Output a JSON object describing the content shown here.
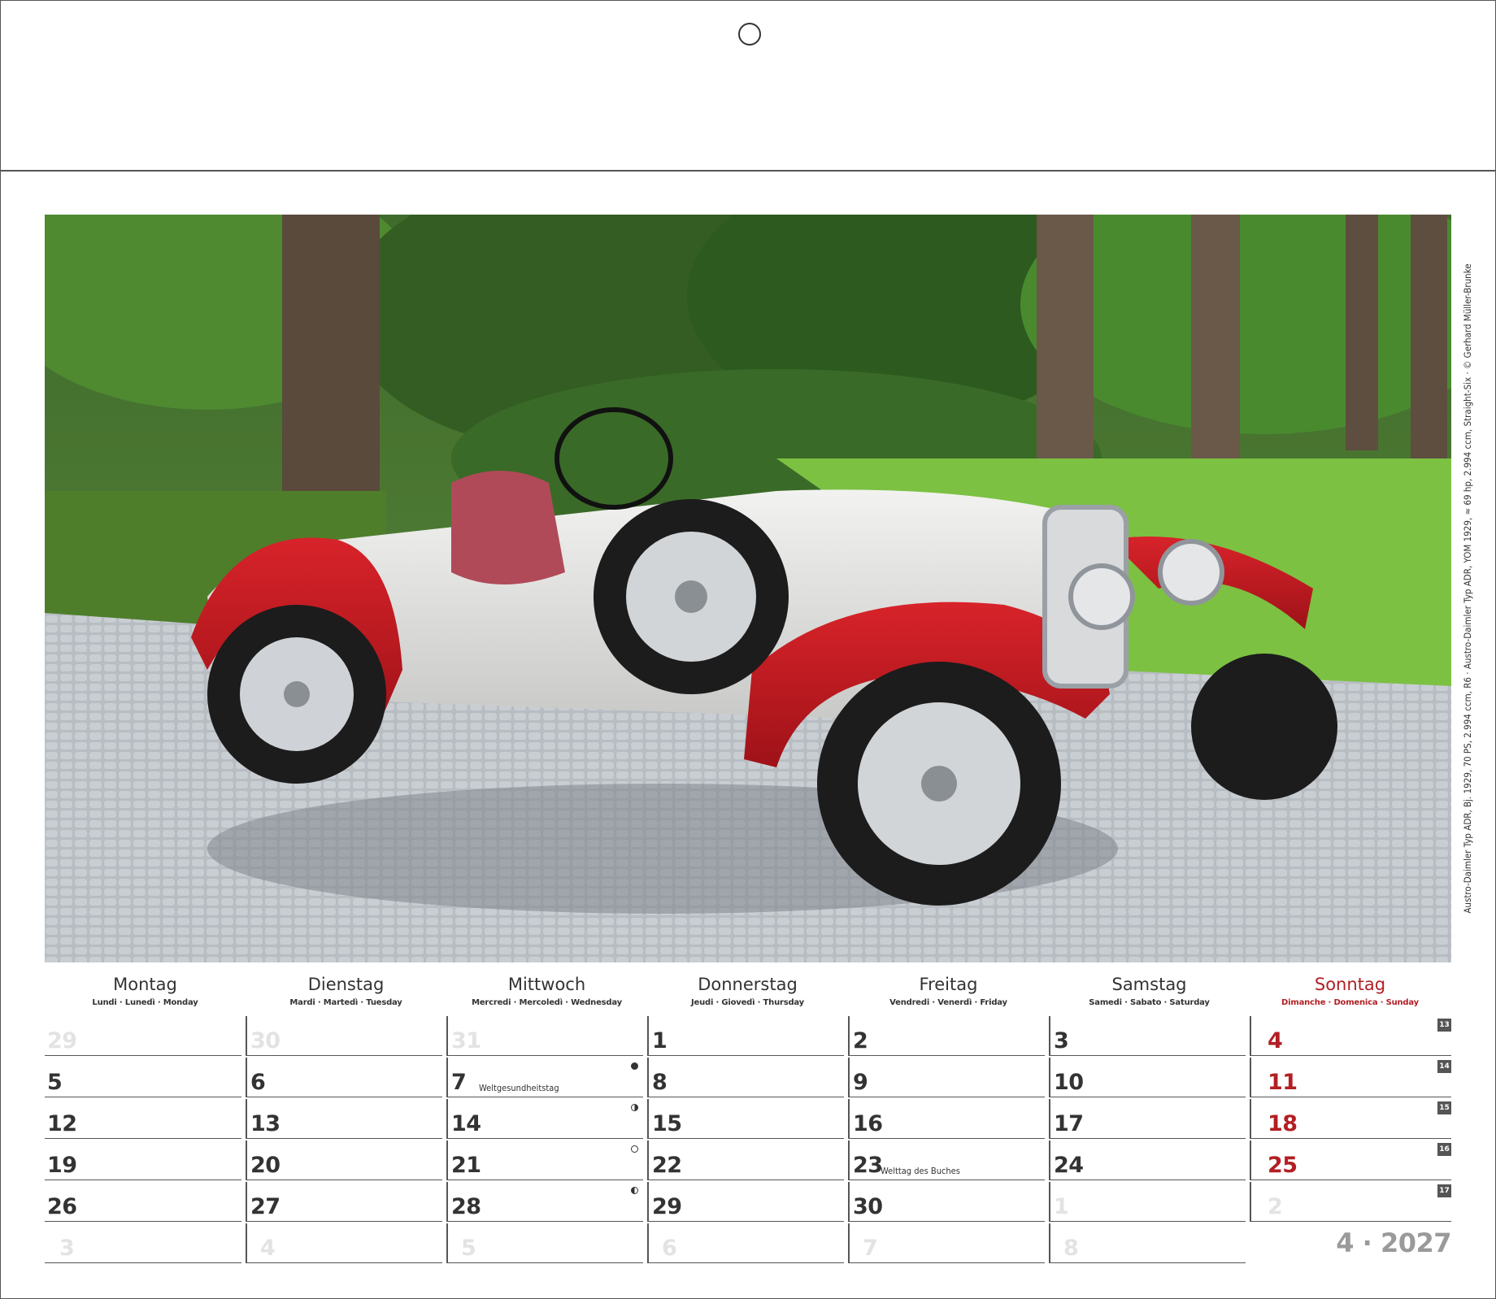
{
  "caption": "Austro-Daimler Typ ADR, Bj. 1929, 70 PS, 2.994 ccm, R6 · Austro-Daimler Typ ADR, YOM 1929, ≈ 69 hp, 2.994 ccm, Straight-Six · © Gerhard Müller-Brunke",
  "calendar": {
    "days": [
      {
        "name": "Montag",
        "sub": "Lundi · Lunedì · Monday"
      },
      {
        "name": "Dienstag",
        "sub": "Mardi · Martedì · Tuesday"
      },
      {
        "name": "Mittwoch",
        "sub": "Mercredi · Mercoledì · Wednesday"
      },
      {
        "name": "Donnerstag",
        "sub": "Jeudi · Giovedì · Thursday"
      },
      {
        "name": "Freitag",
        "sub": "Vendredi · Venerdì · Friday"
      },
      {
        "name": "Samstag",
        "sub": "Samedi · Sabato · Saturday"
      },
      {
        "name": "Sonntag",
        "sub": "Dimanche · Domenica · Sunday"
      }
    ],
    "weeks": [
      {
        "kw": "13",
        "days": [
          "29",
          "30",
          "31",
          "1",
          "2",
          "3",
          "4"
        ]
      },
      {
        "kw": "14",
        "days": [
          "5",
          "6",
          "7",
          "8",
          "9",
          "10",
          "11"
        ]
      },
      {
        "kw": "15",
        "days": [
          "12",
          "13",
          "14",
          "15",
          "16",
          "17",
          "18"
        ]
      },
      {
        "kw": "16",
        "days": [
          "19",
          "20",
          "21",
          "22",
          "23",
          "24",
          "25"
        ]
      },
      {
        "kw": "17",
        "days": [
          "26",
          "27",
          "28",
          "29",
          "30",
          "1",
          "2"
        ]
      },
      {
        "kw": "",
        "days": [
          "3",
          "4",
          "5",
          "6",
          "7",
          "8"
        ]
      }
    ],
    "holidays": {
      "weltgesundheitstag": "Weltgesundheitstag",
      "welttag_buches": "Welttag des Buches"
    },
    "month_year": "4 · 2027"
  },
  "colors": {
    "sunday_red": "#b21f24",
    "text_dark": "#333333",
    "faded": "#e3e3e3"
  },
  "icons": {
    "moon_7": "new-moon-icon",
    "moon_14": "first-quarter-moon-icon",
    "moon_21": "full-moon-icon",
    "moon_28": "last-quarter-moon-icon"
  }
}
